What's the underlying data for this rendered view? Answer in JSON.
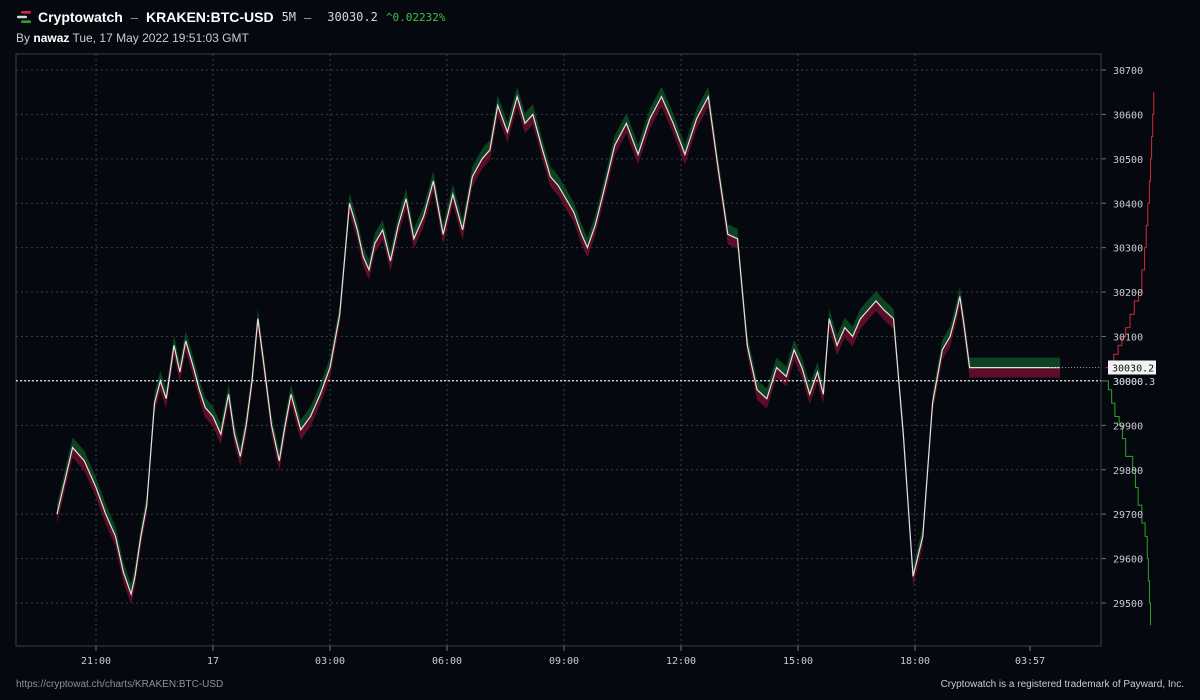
{
  "header": {
    "brand": "Cryptowatch",
    "separator1": "–",
    "pair": "KRAKEN:BTC-USD",
    "interval": "5M",
    "separator2": "–",
    "price": "30030.2",
    "change": "^0.02232%",
    "by_prefix": "By",
    "author": "nawaz",
    "timestamp": "Tue, 17 May 2022 19:51:03 GMT"
  },
  "footer": {
    "url": "https://cryptowat.ch/charts/KRAKEN:BTC-USD",
    "trademark": "Cryptowatch is a registered trademark of Payward, Inc."
  },
  "colors": {
    "background": "#06080f",
    "line": "#e6e1dc",
    "up_fill": "#0e4a26",
    "down_fill": "#6b0f2c",
    "bid": "#2fa02a",
    "ask": "#d2283a",
    "grid": "#3a3e48"
  },
  "chart_data": {
    "type": "line",
    "ylim": [
      29400,
      30740
    ],
    "yticks": [
      29500,
      29600,
      29700,
      29800,
      29900,
      30000,
      30100,
      30200,
      30300,
      30400,
      30500,
      30600,
      30700
    ],
    "ytick_labels": [
      "29500",
      "29600",
      "29700",
      "29800",
      "29900",
      "30000",
      "30100",
      "30200",
      "30300",
      "30400",
      "30500",
      "30600",
      "30700"
    ],
    "grid": true,
    "x_hours": [
      -4.0,
      -3.6,
      -3.3,
      -3.0,
      -2.75,
      -2.5,
      -2.3,
      -2.1,
      -2.0,
      -1.85,
      -1.7,
      -1.5,
      -1.35,
      -1.2,
      -1.0,
      -0.85,
      -0.7,
      -0.5,
      -0.35,
      -0.2,
      0.0,
      0.2,
      0.4,
      0.55,
      0.7,
      0.85,
      1.0,
      1.15,
      1.3,
      1.5,
      1.7,
      1.85,
      2.0,
      2.25,
      2.5,
      2.75,
      3.0,
      3.25,
      3.5,
      3.7,
      3.85,
      4.0,
      4.15,
      4.35,
      4.55,
      4.75,
      4.95,
      5.15,
      5.4,
      5.65,
      5.9,
      6.15,
      6.4,
      6.65,
      6.9,
      7.1,
      7.3,
      7.55,
      7.8,
      8.0,
      8.2,
      8.45,
      8.65,
      8.85,
      9.05,
      9.25,
      9.45,
      9.6,
      9.8,
      10.0,
      10.3,
      10.6,
      10.9,
      11.2,
      11.5,
      11.8,
      12.1,
      12.4,
      12.7,
      12.95,
      13.2,
      13.45,
      13.7,
      13.95,
      14.2,
      14.45,
      14.7,
      14.9,
      15.1,
      15.3,
      15.5,
      15.65,
      15.8,
      16.0,
      16.2,
      16.4,
      16.6,
      16.8,
      17.0,
      17.2,
      17.45,
      17.7,
      17.95,
      18.2,
      18.45,
      18.7,
      18.9,
      19.05,
      19.15,
      19.25,
      19.4,
      19.55,
      19.7,
      19.85,
      20.0,
      20.15,
      20.3,
      20.5,
      20.7,
      20.85,
      20.95,
      21.15,
      21.5,
      21.72
    ],
    "y_price": [
      29700,
      29850,
      29820,
      29760,
      29700,
      29650,
      29570,
      29520,
      29560,
      29650,
      29720,
      29950,
      30000,
      29960,
      30080,
      30020,
      30090,
      30030,
      29980,
      29940,
      29920,
      29880,
      29970,
      29880,
      29830,
      29900,
      30000,
      30140,
      30040,
      29900,
      29820,
      29900,
      29970,
      29890,
      29920,
      29970,
      30030,
      30150,
      30400,
      30340,
      30280,
      30250,
      30310,
      30340,
      30270,
      30350,
      30410,
      30320,
      30370,
      30450,
      30330,
      30420,
      30340,
      30460,
      30500,
      30520,
      30620,
      30560,
      30640,
      30580,
      30600,
      30520,
      30460,
      30440,
      30410,
      30380,
      30330,
      30300,
      30350,
      30420,
      30530,
      30580,
      30510,
      30590,
      30640,
      30580,
      30510,
      30590,
      30640,
      30480,
      30330,
      30320,
      30080,
      29980,
      29960,
      30030,
      30010,
      30070,
      30030,
      29970,
      30020,
      29970,
      30140,
      30080,
      30120,
      30100,
      30140,
      30160,
      30180,
      30160,
      30140,
      29880,
      29560,
      29650,
      29950,
      30070,
      30100,
      30150,
      30190,
      30130,
      30030,
      30030,
      30030,
      30030,
      30030,
      30030,
      30030,
      30030,
      30030,
      30030,
      30030,
      30030,
      30030,
      30030
    ],
    "x_axis": {
      "tick_hours": [
        -3,
        0,
        3,
        6,
        9,
        12,
        15,
        18,
        20.95
      ],
      "tick_labels": [
        "21:00",
        "17",
        "03:00",
        "06:00",
        "09:00",
        "12:00",
        "15:00",
        "18:00",
        "03:57"
      ]
    },
    "last_price": 30030.2,
    "last_price_label": "30030.2",
    "reference_price": 30000.3,
    "reference_label": "30000.3",
    "depth": {
      "asks": [
        [
          30030,
          0.05
        ],
        [
          30045,
          0.12
        ],
        [
          30060,
          0.2
        ],
        [
          30080,
          0.28
        ],
        [
          30100,
          0.35
        ],
        [
          30120,
          0.42
        ],
        [
          30150,
          0.5
        ],
        [
          30180,
          0.58
        ],
        [
          30200,
          0.66
        ],
        [
          30250,
          0.72
        ],
        [
          30300,
          0.77
        ],
        [
          30350,
          0.8
        ],
        [
          30400,
          0.83
        ],
        [
          30450,
          0.86
        ],
        [
          30500,
          0.88
        ],
        [
          30550,
          0.9
        ],
        [
          30600,
          0.92
        ],
        [
          30650,
          0.94
        ]
      ],
      "bids": [
        [
          30000,
          0.05
        ],
        [
          29980,
          0.1
        ],
        [
          29950,
          0.16
        ],
        [
          29920,
          0.22
        ],
        [
          29900,
          0.3
        ],
        [
          29870,
          0.36
        ],
        [
          29830,
          0.42
        ],
        [
          29800,
          0.55
        ],
        [
          29760,
          0.6
        ],
        [
          29720,
          0.65
        ],
        [
          29680,
          0.72
        ],
        [
          29650,
          0.78
        ],
        [
          29600,
          0.82
        ],
        [
          29550,
          0.84
        ],
        [
          29500,
          0.86
        ],
        [
          29450,
          0.88
        ]
      ]
    }
  }
}
